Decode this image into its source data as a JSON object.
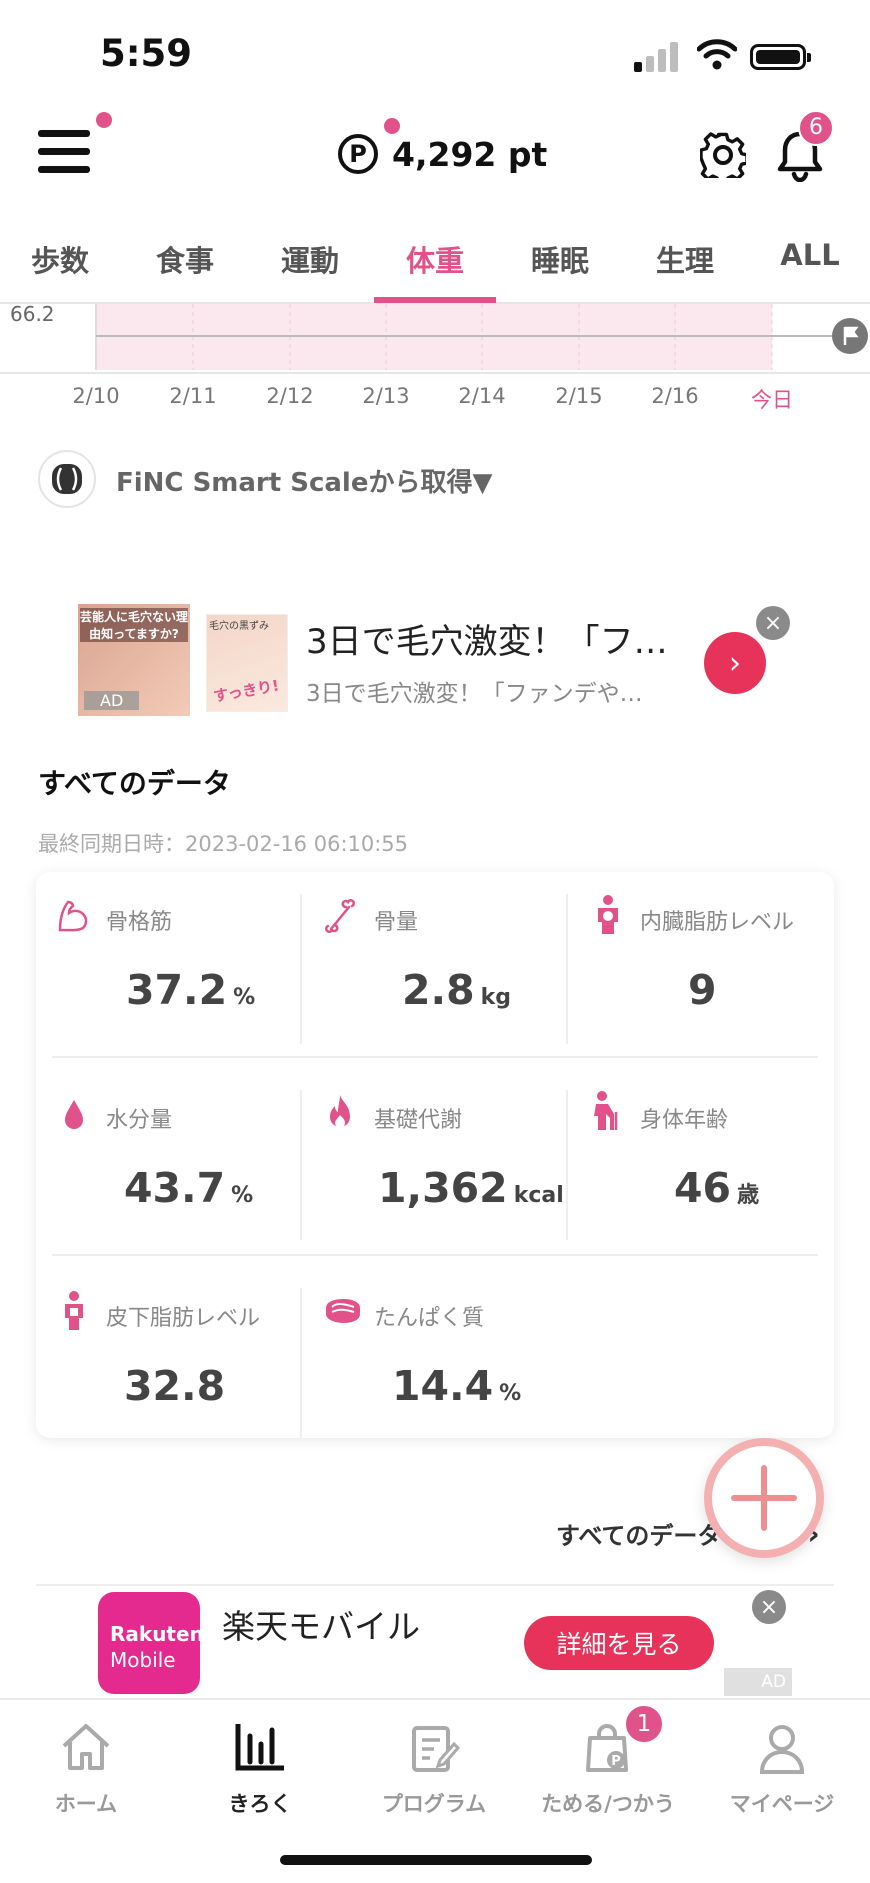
{
  "status_bar": {
    "time": "5:59"
  },
  "header": {
    "points": "4,292 pt",
    "points_symbol": "P",
    "notification_count": "6"
  },
  "tabs": [
    {
      "label": "歩数"
    },
    {
      "label": "食事"
    },
    {
      "label": "運動"
    },
    {
      "label": "体重",
      "active": true
    },
    {
      "label": "睡眠"
    },
    {
      "label": "生理"
    },
    {
      "label": "ALL"
    }
  ],
  "graph": {
    "y_label": "66.2",
    "dates": [
      "2/10",
      "2/11",
      "2/12",
      "2/13",
      "2/14",
      "2/15",
      "2/16",
      "今日"
    ]
  },
  "source": {
    "text": "FiNC Smart Scaleから取得▼"
  },
  "ad1": {
    "thumb_text": "芸能人に毛穴ない理由知ってますか?",
    "thumb_ad": "AD",
    "thumb2_top": "毛穴の黒ずみ",
    "thumb2_text": "すっきり!",
    "title": "3日で毛穴激変！「フ…",
    "subtitle": "3日で毛穴激変！「ファンデや…",
    "arrow": "›",
    "close": "×"
  },
  "data_section": {
    "title": "すべてのデータ",
    "sync": "最終同期日時：2023-02-16 06:10:55",
    "metrics": [
      {
        "label": "骨格筋",
        "value": "37.2",
        "unit": "%",
        "icon": "muscle-icon"
      },
      {
        "label": "骨量",
        "value": "2.8",
        "unit": "kg",
        "icon": "bone-icon"
      },
      {
        "label": "内臓脂肪レベル",
        "value": "9",
        "unit": "",
        "icon": "visceral-fat-icon"
      },
      {
        "label": "水分量",
        "value": "43.7",
        "unit": "%",
        "icon": "water-drop-icon"
      },
      {
        "label": "基礎代謝",
        "value": "1,362",
        "unit": "kcal",
        "icon": "flame-icon"
      },
      {
        "label": "身体年齢",
        "value": "46",
        "unit": "歳",
        "icon": "elderly-person-icon"
      },
      {
        "label": "皮下脂肪レベル",
        "value": "32.8",
        "unit": "",
        "icon": "body-fat-icon"
      },
      {
        "label": "たんぱく質",
        "value": "14.4",
        "unit": "%",
        "icon": "meat-icon"
      }
    ],
    "all_link": "すべてのデータ",
    "all_link_arrow": "›"
  },
  "ad2": {
    "logo_line1": "Rakuten",
    "logo_line2": "Mobile",
    "title": "楽天モバイル",
    "button": "詳細を見る",
    "ad_tag": "AD",
    "close": "×"
  },
  "bottom_nav": [
    {
      "label": "ホーム",
      "icon": "home-icon"
    },
    {
      "label": "きろく",
      "icon": "chart-icon",
      "active": true
    },
    {
      "label": "プログラム",
      "icon": "program-icon"
    },
    {
      "label": "ためる/つかう",
      "icon": "points-bag-icon",
      "badge": "1"
    },
    {
      "label": "マイページ",
      "icon": "profile-icon"
    }
  ],
  "colors": {
    "accent": "#e2528a",
    "ad_button": "#e7335a",
    "rakuten": "#e52a8f"
  }
}
